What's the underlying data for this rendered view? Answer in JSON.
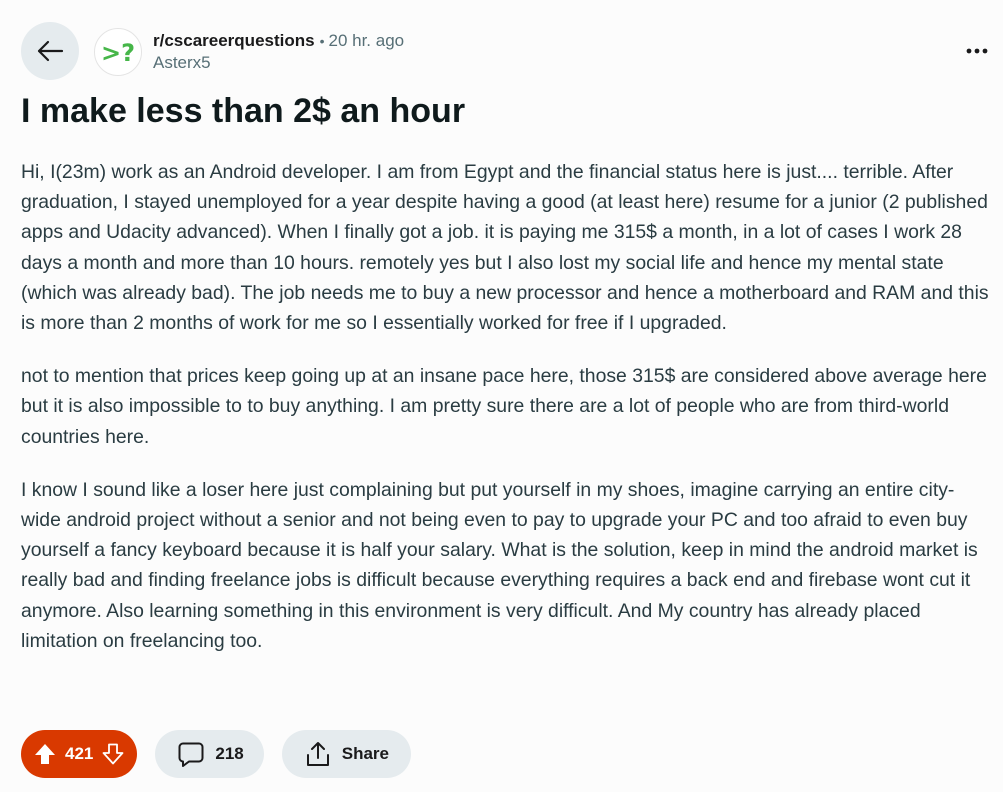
{
  "post": {
    "subreddit": "r/cscareerquestions",
    "separator": "•",
    "time_ago": "20 hr. ago",
    "author": "Asterx5",
    "title": "I make less than 2$ an hour",
    "paragraphs": [
      "Hi, I(23m) work as an Android developer. I am from Egypt and the financial status here is just.... terrible. After graduation, I stayed unemployed for a year despite having a good (at least here) resume for a junior (2 published apps and Udacity advanced). When I finally got a job. it is paying me 315$ a month, in a lot of cases I work 28 days a month and more than 10 hours. remotely yes but I also lost my social life and hence my mental state (which was already bad). The job needs me to buy a new processor and hence a motherboard and RAM and this is more than 2 months of work for me so I essentially worked for free if I upgraded.",
      "not to mention that prices keep going up at an insane pace here, those 315$ are considered above average here but it is also impossible to to buy anything. I am pretty sure there are a lot of people who are from third-world countries here.",
      "I know I sound like a loser here just complaining but put yourself in my shoes, imagine carrying an entire city-wide android project without a senior and not being even to pay to upgrade your PC and too afraid to even buy yourself a fancy keyboard because it is half your salary. What is the solution, keep in mind the android market is really bad and finding freelance jobs is difficult because everything requires a back end and firebase wont cut it anymore. Also learning something in this environment is very difficult. And My country has already placed limitation on freelancing too."
    ]
  },
  "actions": {
    "vote_count": "421",
    "comment_count": "218",
    "share_label": "Share"
  },
  "subreddit_icon_text": ">?",
  "icons": {
    "back": "arrow-left-icon",
    "more": "more-horizontal-icon",
    "upvote": "upvote-icon",
    "downvote": "downvote-icon",
    "comment": "comment-icon",
    "share": "share-icon"
  },
  "colors": {
    "upvote_active": "#d93900",
    "pill_bg": "#e5ebee",
    "subreddit_icon": "#46b649"
  }
}
